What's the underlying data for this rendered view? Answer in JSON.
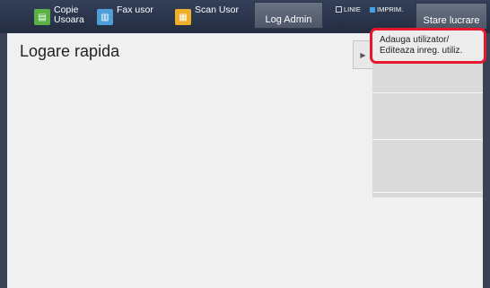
{
  "topbar": {
    "apps": [
      {
        "label": "Copie\nUsoara",
        "icon": "copy-icon"
      },
      {
        "label": "Fax usor",
        "icon": "fax-icon"
      },
      {
        "label": "Scan Usor",
        "icon": "scan-icon"
      }
    ],
    "login_label": "Log Admin",
    "status_linie": "LINIE",
    "status_imprim": "IMPRIM.",
    "job_status_label": "Stare lucrare"
  },
  "main": {
    "title": "Logare rapida"
  },
  "menu": {
    "items": [
      {
        "label": "Adauga utilizator/\nEditeaza inreg. utiliz."
      },
      {
        "label": ""
      },
      {
        "label": ""
      },
      {
        "label": ""
      },
      {
        "label": ""
      },
      {
        "label": ""
      }
    ]
  },
  "colors": {
    "accent_red": "#e8182c",
    "topbar": "#2b3447",
    "copy_green": "#5bb046",
    "fax_blue": "#4e9fd8",
    "scan_orange": "#efae2a"
  }
}
